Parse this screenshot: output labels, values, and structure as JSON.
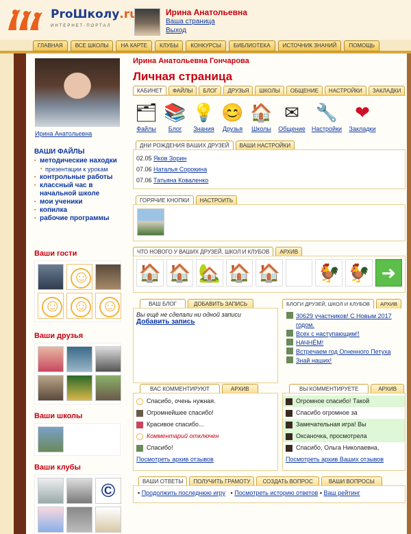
{
  "header": {
    "logo_text": "ProШколу",
    "logo_suffix": ".ru",
    "logo_sub": "ИНТЕРНЕТ-ПОРТАЛ",
    "user_name": "Ирина Анатольевна",
    "my_page_link": "Ваша страница",
    "logout_link": "Выход"
  },
  "nav": [
    "ГЛАВНАЯ",
    "ВСЕ ШКОЛЫ",
    "НА КАРТЕ",
    "КЛУБЫ",
    "КОНКУРСЫ",
    "БИБЛИОТЕКА",
    "ИСТОЧНИК ЗНАНИЙ",
    "ПОМОЩЬ"
  ],
  "sidebar": {
    "photo_caption": "Ирина Анатольевна",
    "files_title": "ВАШИ ФАЙЛЫ",
    "files": {
      "item0": "методические находки",
      "sub0": "презентации к урокам",
      "item1": "контрольные работы",
      "item2": "классный час в начальной школе",
      "item3": "мои ученики",
      "item4": "копилка",
      "item5": "рабочие программы"
    },
    "guests_title": "Ваши гости",
    "friends_title": "Ваши друзья",
    "schools_title": "Ваши школы",
    "clubs_title": "Ваши клубы"
  },
  "main": {
    "full_name": "Ирина Анатольевна Гончарова",
    "page_title": "Личная страница",
    "tabs": [
      "КАБИНЕТ",
      "ФАЙЛЫ",
      "БЛОГ",
      "ДРУЗЬЯ",
      "ШКОЛЫ",
      "ОБЩЕНИЕ",
      "НАСТРОЙКИ",
      "ЗАКЛАДКИ"
    ],
    "icons": [
      {
        "label": "Файлы",
        "icon": "files-icon",
        "glyph": "🗂"
      },
      {
        "label": "Блог",
        "icon": "blog-icon",
        "glyph": "📚"
      },
      {
        "label": "Знания",
        "icon": "knowledge-icon",
        "glyph": "💡"
      },
      {
        "label": "Друзья",
        "icon": "friends-icon",
        "glyph": "😊"
      },
      {
        "label": "Школы",
        "icon": "schools-icon",
        "glyph": "🏠"
      },
      {
        "label": "Общение",
        "icon": "mail-icon",
        "glyph": "✉"
      },
      {
        "label": "Настройки",
        "icon": "wrench-icon",
        "glyph": "🔧"
      },
      {
        "label": "Закладки",
        "icon": "heart-icon",
        "glyph": "❤"
      }
    ],
    "birthday_tab": "ДНИ РОЖДЕНИЯ ВАШИХ ДРУЗЕЙ",
    "settings_tab": "ВАШИ НАСТРОЙКИ",
    "birthdays": [
      {
        "date": "02.05",
        "name": "Яков Зорин"
      },
      {
        "date": "07.06",
        "name": "Наталья Сорокина"
      },
      {
        "date": "07.06",
        "name": "Татьяна Коваленко"
      }
    ],
    "hotkeys_tab": "ГОРЯЧИЕ КНОПКИ",
    "hotkeys_setup": "НАСТРОИТЬ",
    "news_tab": "ЧТО НОВОГО У ВАШИХ ДРУЗЕЙ, ШКОЛ И КЛУБОВ",
    "archive_tab": "АРХИВ",
    "blog_tab": "ВАШ БЛОГ",
    "add_post_tab": "ДОБАВИТЬ ЗАПИСЬ",
    "blog_empty": "Вы ещё не сделали ни одной записи",
    "blog_add": "Добавить запись",
    "friends_blogs_tab": "БЛОГИ ДРУЗЕЙ, ШКОЛ И КЛУБОВ",
    "friends_blogs_archive": "АРХИВ",
    "friends_blogs": [
      "30629 участников! С Новым 2017 годом.",
      "Всех с наступающим!!",
      "НАЧНЁМ!",
      "Встречаем год Огненного Петуха",
      "Знай наших!"
    ],
    "commented_you_tab": "ВАС КОММЕНТИРУЮТ",
    "commented_you_archive": "АРХИВ",
    "commented_you": [
      "Спасибо, очень нужная.",
      "Огромнейшее спасибо!",
      "Красивое спасибо...",
      "Комментарий отключен",
      "Спасибо!"
    ],
    "commented_you_link": "Посмотреть архив отзывов",
    "you_comment_tab": "ВЫ КОММЕНТИРУЕТЕ",
    "you_comment_archive": "АРХИВ",
    "you_comment": [
      "Огромное спасибо! Такой",
      "Спасибо огромное за",
      "Замечательная игра! Вы",
      "Оксаночка, просмотрела",
      "Спасибо, Ольга Николаевна,"
    ],
    "you_comment_link": "Посмотреть архив Ваших отзывов",
    "bottom_tabs": [
      "ВАШИ ОТВЕТЫ",
      "ПОЛУЧИТЬ ГРАМОТУ",
      "СОЗДАТЬ ВОПРОС",
      "ВАШИ ВОПРОСЫ"
    ],
    "bottom_links": [
      "Продолжить последнюю игру",
      "Посмотреть историю ответов",
      "Ваш рейтинг"
    ]
  },
  "colors": {
    "accent_red": "#c60010",
    "link_blue": "#0a35a0",
    "tab_gold": "#f3c65a",
    "frame_brown": "#6b2d15"
  }
}
